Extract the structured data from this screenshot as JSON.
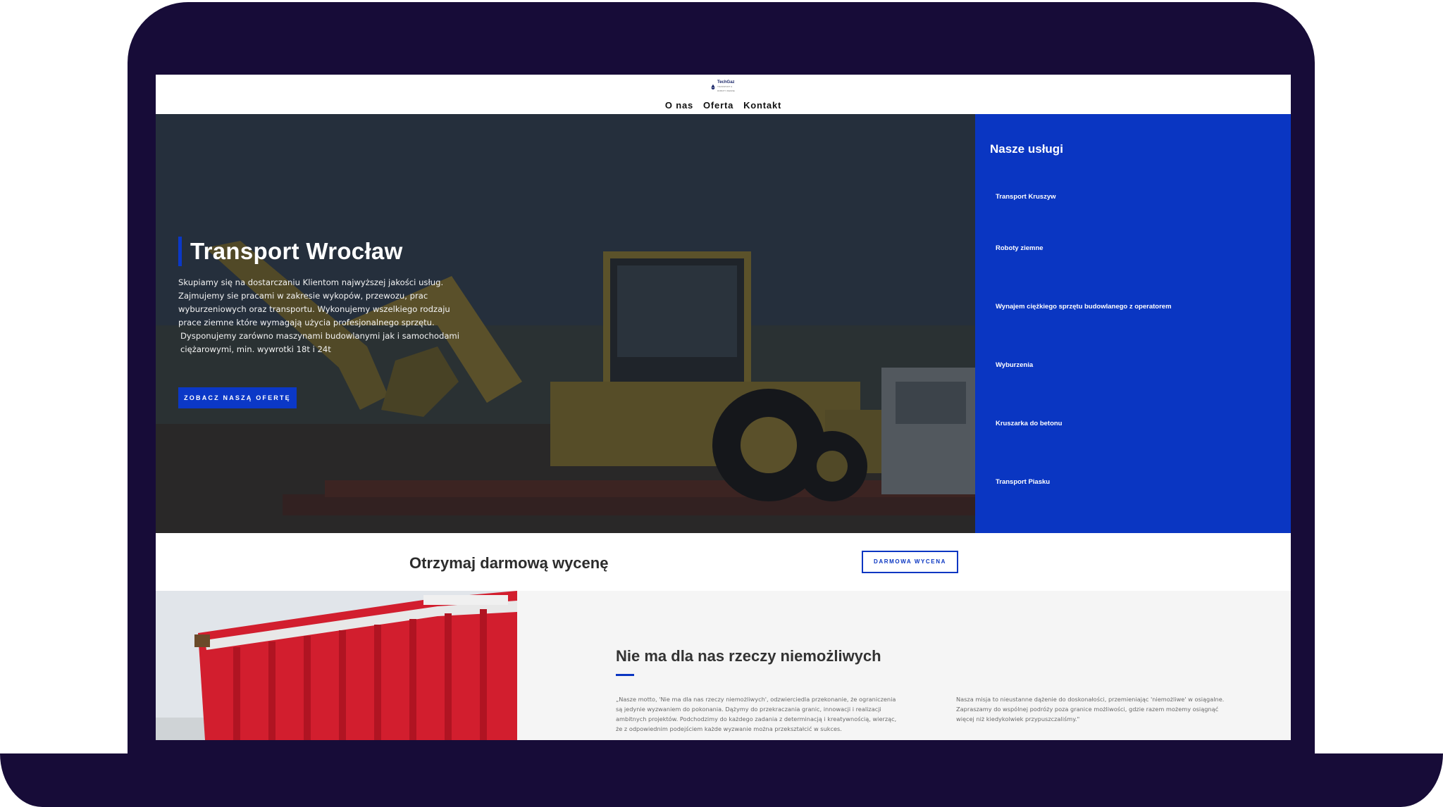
{
  "logo": {
    "name": "TechGaz",
    "tagline": "TRANSPORT & ROBOTY ZIEMNE"
  },
  "nav": {
    "items": [
      "O nas",
      "Oferta",
      "Kontakt"
    ]
  },
  "hero": {
    "title": "Transport Wrocław",
    "paragraphs": [
      "Skupiamy się na dostarczaniu Klientom najwyższej jakości usług. Zajmujemy sie pracami w zakresie wykopów, przewozu, prac wyburzeniowych oraz transportu. Wykonujemy wszelkiego rodzaju prace ziemne które wymagają użycia profesjonalnego sprzętu.",
      "Dysponujemy zarówno maszynami budowlanymi jak i samochodami ciężarowymi, min. wywrotki 18t i 24t"
    ],
    "cta_label": "ZOBACZ NASZĄ OFERTĘ"
  },
  "services": {
    "title": "Nasze usługi",
    "items": [
      "Transport Kruszyw",
      "Roboty ziemne",
      "Wynajem ciężkiego sprzętu budowlanego z operatorem",
      "Wyburzenia",
      "Kruszarka do betonu",
      "Transport Piasku"
    ]
  },
  "quote": {
    "title": "Otrzymaj darmową wycenę",
    "button_label": "DARMOWA WYCENA"
  },
  "about": {
    "title": "Nie ma dla nas rzeczy niemożliwych",
    "col1": "„Nasze motto, 'Nie ma dla nas rzeczy niemożliwych', odzwierciedla przekonanie, że ograniczenia są jedynie wyzwaniem do pokonania. Dążymy do przekraczania granic, innowacji i realizacji ambitnych projektów. Podchodzimy do każdego zadania z determinacją i kreatywnością, wierząc, że z odpowiednim podejściem każde wyzwanie można przekształcić w sukces.",
    "col2": "Nasza misja to nieustanne dążenie do doskonałości, przemieniając 'niemożliwe' w osiągalne. Zapraszamy do wspólnej podróży poza granice możliwości, gdzie razem możemy osiągnąć więcej niż kiedykolwiek przypuszczaliśmy.\""
  },
  "colors": {
    "brand_blue": "#0a36c2",
    "laptop_frame": "#170c38"
  },
  "icons": {
    "logo_mark": "oil-drop-logo-icon"
  }
}
